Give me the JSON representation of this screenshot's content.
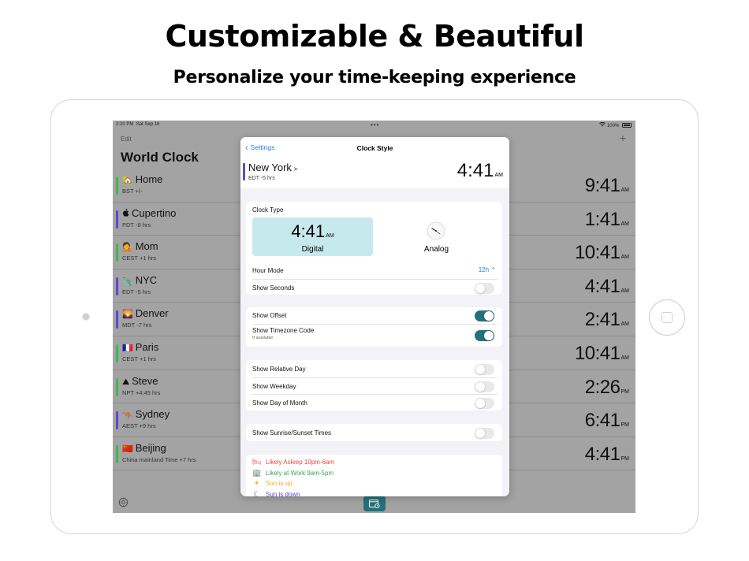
{
  "promo": {
    "headline": "Customizable & Beautiful",
    "subheadline": "Personalize your time-keeping experience"
  },
  "status_bar": {
    "time": "2:20 PM",
    "date": "Sat Sep 16",
    "more_dots": "•••",
    "battery": "100%"
  },
  "world_clock": {
    "edit_label": "Edit",
    "add_label": "+",
    "title": "World Clock",
    "rows": [
      {
        "icon": "🏡",
        "name": "Home",
        "offset": "BST +/-",
        "time": "9:41",
        "ampm": "AM",
        "bar_color": "#3fb950"
      },
      {
        "icon": "",
        "name": "Cupertino",
        "offset": "PDT -8 hrs",
        "time": "1:41",
        "ampm": "AM",
        "bar_color": "#5b49d8"
      },
      {
        "icon": "💁",
        "name": "Mom",
        "offset": "CEST +1 hrs",
        "time": "10:41",
        "ampm": "AM",
        "bar_color": "#3fb950"
      },
      {
        "icon": "🗽",
        "name": "NYC",
        "offset": "EDT -5 hrs",
        "time": "4:41",
        "ampm": "AM",
        "bar_color": "#5b49d8"
      },
      {
        "icon": "🌄",
        "name": "Denver",
        "offset": "MDT -7 hrs",
        "time": "2:41",
        "ampm": "AM",
        "bar_color": "#5b49d8"
      },
      {
        "icon": "🇫🇷",
        "name": "Paris",
        "offset": "CEST +1 hrs",
        "time": "10:41",
        "ampm": "AM",
        "bar_color": "#3fb950"
      },
      {
        "icon": "⛰",
        "name": "Steve",
        "offset": "NPT +4:45 hrs",
        "time": "2:26",
        "ampm": "PM",
        "bar_color": "#3fb950"
      },
      {
        "icon": "🦘",
        "name": "Sydney",
        "offset": "AEST +9 hrs",
        "time": "6:41",
        "ampm": "PM",
        "bar_color": "#5b49d8"
      },
      {
        "icon": "🇨🇳",
        "name": "Beijing",
        "offset": "China mainland Time +7 hrs",
        "time": "4:41",
        "ampm": "PM",
        "bar_color": "#3fb950"
      }
    ]
  },
  "clock_style": {
    "back_label": "Settings",
    "title": "Clock Style",
    "preview": {
      "city": "New York",
      "arrow": "➤",
      "offset": "EDT -5 hrs",
      "time": "4:41",
      "ampm": "AM"
    },
    "clock_type": {
      "label": "Clock Type",
      "digital": {
        "time": "4:41",
        "ampm": "AM",
        "label": "Digital",
        "selected": true
      },
      "analog": {
        "label": "Analog",
        "selected": false
      }
    },
    "hour_mode": {
      "label": "Hour Mode",
      "value": "12h ⌃"
    },
    "show_seconds": {
      "label": "Show Seconds",
      "on": false
    },
    "show_offset": {
      "label": "Show Offset",
      "on": true
    },
    "show_timezone_code": {
      "label": "Show Timezone Code",
      "hint": "If available",
      "on": true
    },
    "show_relative_day": {
      "label": "Show Relative Day",
      "on": false
    },
    "show_weekday": {
      "label": "Show Weekday",
      "on": false
    },
    "show_day_of_month": {
      "label": "Show Day of Month",
      "on": false
    },
    "show_sunrise_sunset": {
      "label": "Show Sunrise/Sunset Times",
      "on": false
    },
    "legend": [
      {
        "icon": "bed-icon",
        "glyph": "🛏",
        "text": "Likely Asleep 10pm-6am",
        "color": "#e5483d"
      },
      {
        "icon": "office-icon",
        "glyph": "🏢",
        "text": "Likely at Work 9am-5pm",
        "color": "#34a853"
      },
      {
        "icon": "sun-icon",
        "glyph": "☀",
        "text": "Sun is up",
        "color": "#f2a91f"
      },
      {
        "icon": "moon-icon",
        "glyph": "☾",
        "text": "Sun is down",
        "color": "#5b49d8"
      }
    ]
  },
  "colors": {
    "accent_teal": "#24717a",
    "link_blue": "#2e7fd6",
    "digital_card_bg": "#c6e9ee"
  }
}
